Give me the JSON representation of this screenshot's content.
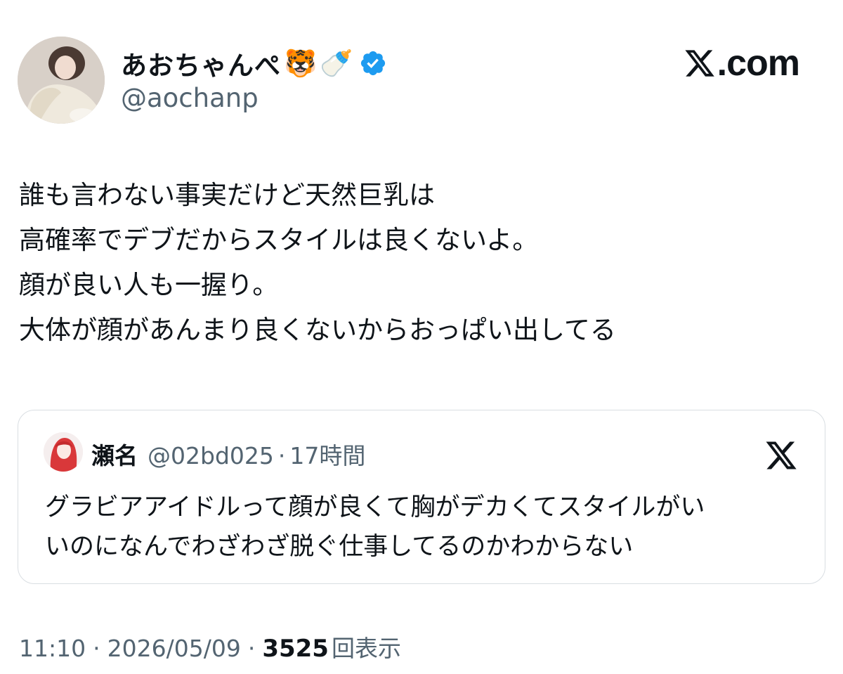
{
  "author": {
    "display_name": "あおちゃんぺ",
    "emoji_1": "🐯",
    "emoji_2": "🍼",
    "handle": "@aochanp",
    "avatar_icon": "profile-photo",
    "verified_icon": "verified-badge-icon",
    "verified_color": "#1d9bf0"
  },
  "brand": {
    "label": ".com",
    "icon": "x-logo-icon"
  },
  "tweet": {
    "lines": [
      "誰も言わない事実だけど天然巨乳は",
      "高確率でデブだからスタイルは良くないよ。",
      "顔が良い人も一握り。",
      "大体が顔があんまり良くないからおっぱい出してる"
    ]
  },
  "quote": {
    "name": "瀬名",
    "handle": "@02bd025",
    "separator": "·",
    "time": "17時間",
    "lines": [
      "グラビアアイドルって顔が良くて胸がデカくてスタイルがい",
      "いのになんでわざわざ脱ぐ仕事してるのかわからない"
    ]
  },
  "meta": {
    "time": "11:10",
    "sep": "·",
    "date": "2026/05/09",
    "views_count": "3525",
    "views_label": "回表示"
  },
  "colors": {
    "text": "#0f1419",
    "secondary": "#536471",
    "border": "#d9dee2",
    "accent": "#1d9bf0"
  }
}
